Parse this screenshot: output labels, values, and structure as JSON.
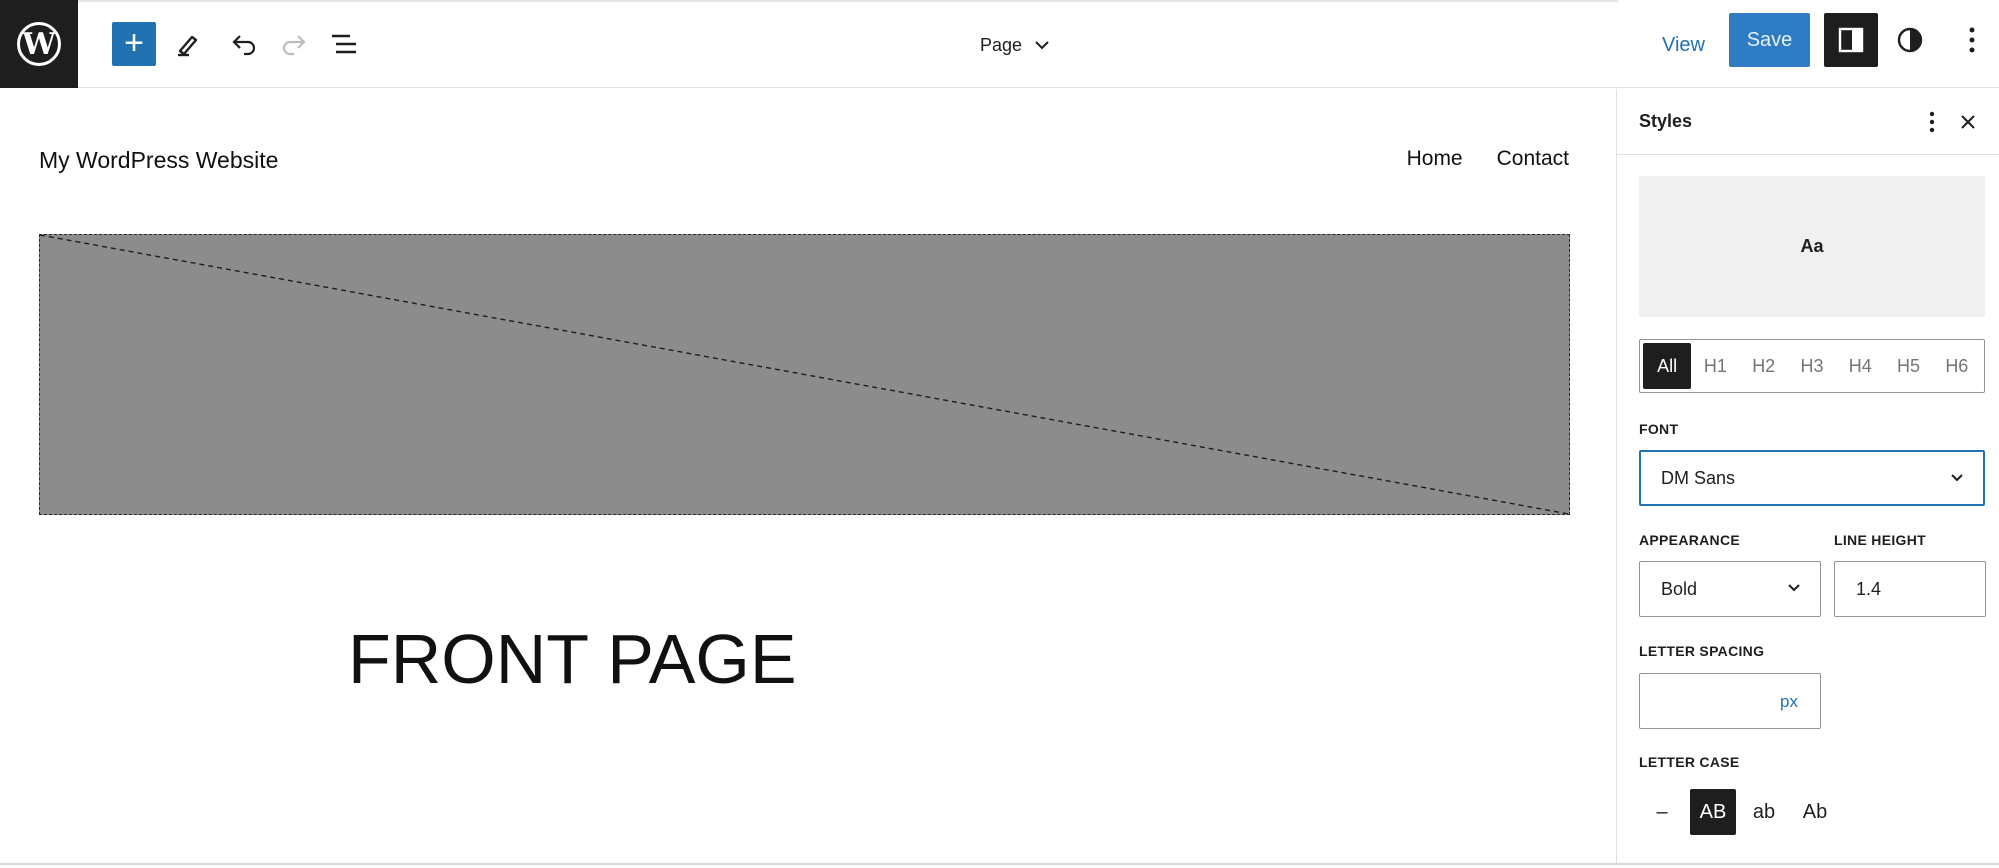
{
  "toolbar": {
    "logo_letter": "W",
    "add_symbol": "+",
    "document_title": "Page",
    "view_label": "View",
    "save_label": "Save"
  },
  "canvas": {
    "site_title": "My WordPress Website",
    "nav": [
      "Home",
      "Contact"
    ],
    "front_title": "FRONT PAGE"
  },
  "sidebar": {
    "title": "Styles",
    "preview_text": "Aa",
    "element_tabs": [
      "All",
      "H1",
      "H2",
      "H3",
      "H4",
      "H5",
      "H6"
    ],
    "active_tab": "All",
    "font_label": "FONT",
    "font_value": "DM Sans",
    "appearance_label": "APPEARANCE",
    "appearance_value": "Bold",
    "line_height_label": "LINE HEIGHT",
    "line_height_value": "1.4",
    "letter_spacing_label": "LETTER SPACING",
    "letter_spacing_value": "",
    "letter_spacing_unit": "px",
    "letter_case_label": "LETTER CASE",
    "letter_case_options": [
      "–",
      "AB",
      "ab",
      "Ab"
    ],
    "active_letter_case": "AB"
  },
  "colors": {
    "accent": "#2271b1",
    "dark": "#1e1e1e",
    "placeholder": "#8c8c8c"
  },
  "icons": [
    "wordpress-logo-icon",
    "plus-icon",
    "pencil-icon",
    "undo-icon",
    "redo-icon",
    "list-view-icon",
    "chevron-down-icon",
    "sidebar-icon",
    "contrast-icon",
    "vertical-ellipsis-icon",
    "close-icon"
  ]
}
